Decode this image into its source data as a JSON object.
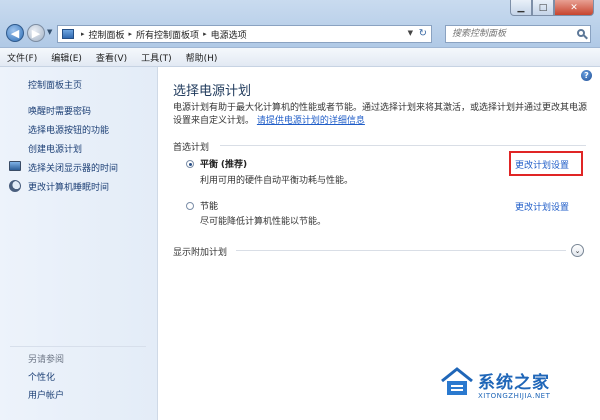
{
  "window": {
    "caption_min": "▁",
    "caption_max": "□",
    "caption_close": "✕"
  },
  "address": {
    "back_icon": "◀",
    "forward_icon": "▶",
    "dropdown_icon": "▼",
    "refresh_icon": "↻",
    "breadcrumbs": [
      "控制面板",
      "所有控制面板项",
      "电源选项"
    ],
    "separator": "▸"
  },
  "search": {
    "placeholder": "搜索控制面板"
  },
  "menu": [
    "文件(F)",
    "编辑(E)",
    "查看(V)",
    "工具(T)",
    "帮助(H)"
  ],
  "sidebar": {
    "home": "控制面板主页",
    "links": [
      "唤醒时需要密码",
      "选择电源按钮的功能",
      "创建电源计划",
      "选择关闭显示器的时间",
      "更改计算机睡眠时间"
    ],
    "see_also": "另请参阅",
    "see_also_links": [
      "个性化",
      "用户帐户"
    ]
  },
  "main": {
    "help": "?",
    "title": "选择电源计划",
    "desc_text": "电源计划有助于最大化计算机的性能或者节能。通过选择计划来将其激活，或选择计划并通过更改其电源设置来自定义计划。",
    "desc_link": "请提供电源计划的详细信息",
    "preferred_label": "首选计划",
    "plans": [
      {
        "name": "平衡",
        "tag": "(推荐)",
        "desc": "利用可用的硬件自动平衡功耗与性能。",
        "link": "更改计划设置",
        "selected": true
      },
      {
        "name": "节能",
        "tag": "",
        "desc": "尽可能降低计算机性能以节能。",
        "link": "更改计划设置",
        "selected": false
      }
    ],
    "additional_label": "显示附加计划",
    "expand_icon": "⌄"
  },
  "watermark": {
    "text": "系统之家",
    "sub": "XITONGZHIJIA.NET"
  }
}
